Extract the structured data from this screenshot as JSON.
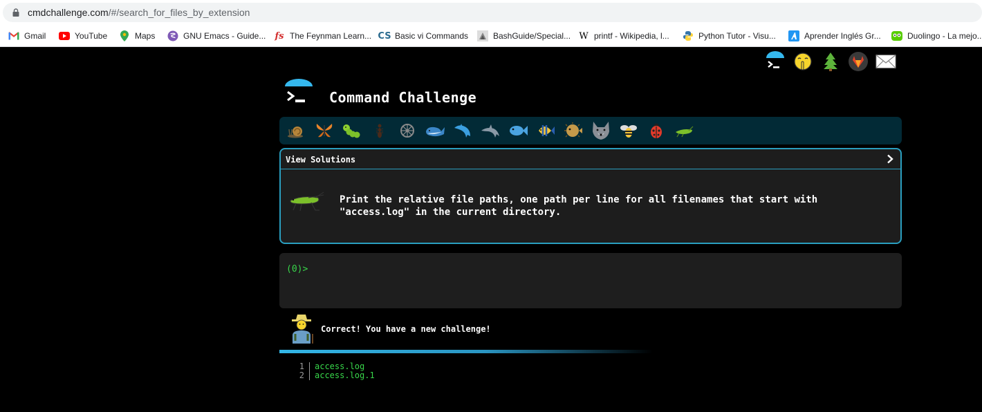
{
  "browser": {
    "url_host": "cmdchallenge.com",
    "url_path": "/#/search_for_files_by_extension",
    "bookmarks": [
      {
        "label": "Gmail",
        "icon": "gmail-icon"
      },
      {
        "label": "YouTube",
        "icon": "youtube-icon"
      },
      {
        "label": "Maps",
        "icon": "maps-icon"
      },
      {
        "label": "GNU Emacs - Guide...",
        "icon": "emacs-icon"
      },
      {
        "label": "The Feynman Learn...",
        "icon": "feynman-icon"
      },
      {
        "label": "Basic vi Commands",
        "icon": "cs-icon"
      },
      {
        "label": "BashGuide/Special...",
        "icon": "bashguide-icon"
      },
      {
        "label": "printf - Wikipedia, l...",
        "icon": "wikipedia-icon"
      },
      {
        "label": "Python Tutor - Visu...",
        "icon": "python-icon"
      },
      {
        "label": "Aprender Inglés Gr...",
        "icon": "aprender-icon"
      },
      {
        "label": "Duolingo - La mejo...",
        "icon": "duolingo-icon"
      }
    ]
  },
  "header": {
    "title": "Command Challenge",
    "top_icons": [
      "terminal-icon",
      "shushing-face-icon",
      "tree-icon",
      "gitlab-icon",
      "mail-icon"
    ]
  },
  "levels": [
    "snail",
    "butterfly",
    "caterpillar",
    "ant",
    "wheel",
    "whale",
    "dolphin",
    "dolphin-gray",
    "fish",
    "tropical-fish",
    "blowfish",
    "wolf",
    "bee",
    "ladybug",
    "cricket"
  ],
  "challenge": {
    "header_label": "View Solutions",
    "description_line1": "Print the relative file paths, one path per line for all filenames that start with",
    "description_line2": "\"access.log\" in the current directory."
  },
  "terminal": {
    "prompt": "(0)>"
  },
  "feedback": {
    "message": "Correct! You have a new challenge!"
  },
  "output": [
    {
      "line": "1",
      "text": "access.log"
    },
    {
      "line": "2",
      "text": "access.log.1"
    }
  ],
  "colors": {
    "accent": "#2a9fc0",
    "prompt_green": "#38d64a",
    "level_bar_bg": "#022a36"
  }
}
